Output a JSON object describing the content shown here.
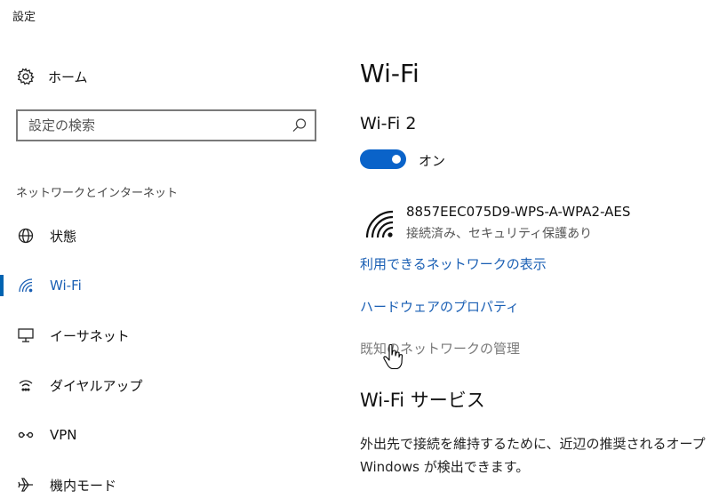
{
  "window": {
    "title": "設定"
  },
  "sidebar": {
    "home": {
      "label": "ホーム",
      "icon": "gear-icon"
    },
    "search": {
      "placeholder": "設定の検索",
      "value": "",
      "icon": "search-icon"
    },
    "section_header": "ネットワークとインターネット",
    "items": [
      {
        "label": "状態",
        "icon": "globe-icon",
        "active": false
      },
      {
        "label": "Wi-Fi",
        "icon": "wifi-icon",
        "active": true
      },
      {
        "label": "イーサネット",
        "icon": "ethernet-icon",
        "active": false
      },
      {
        "label": "ダイヤルアップ",
        "icon": "dialup-icon",
        "active": false
      },
      {
        "label": "VPN",
        "icon": "vpn-icon",
        "active": false
      },
      {
        "label": "機内モード",
        "icon": "airplane-icon",
        "active": false
      }
    ]
  },
  "main": {
    "title": "Wi-Fi",
    "adapter": "Wi-Fi 2",
    "toggle": {
      "state": "on",
      "label": "オン"
    },
    "network": {
      "ssid": "8857EEC075D9-WPS-A-WPA2-AES",
      "status": "接続済み、セキュリティ保護あり",
      "icon": "wifi-signal-icon"
    },
    "links": {
      "show_available": "利用できるネットワークの表示",
      "hardware_properties": "ハードウェアのプロパティ",
      "manage_known": "既知のネットワークの管理"
    },
    "services": {
      "title": "Wi-Fi サービス",
      "description_line1": "外出先で接続を維持するために、近辺の推奨されるオープ",
      "description_line2": "Windows が検出できます。"
    }
  },
  "colors": {
    "accent": "#0063b1",
    "link": "#1a5fb4",
    "toggle_on": "#0a63c9",
    "muted_link": "#7a7a7a"
  }
}
